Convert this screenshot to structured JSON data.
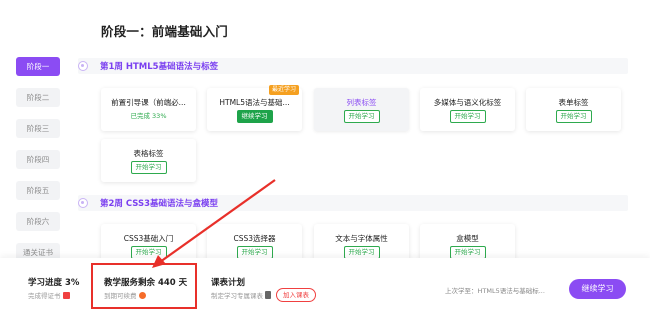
{
  "page_title": "阶段一：前端基础入门",
  "sidebar": {
    "stages": [
      {
        "label": "阶段一",
        "active": true
      },
      {
        "label": "阶段二",
        "active": false
      },
      {
        "label": "阶段三",
        "active": false
      },
      {
        "label": "阶段四",
        "active": false
      },
      {
        "label": "阶段五",
        "active": false
      },
      {
        "label": "阶段六",
        "active": false
      },
      {
        "label": "通关证书",
        "active": false
      }
    ]
  },
  "weeks": [
    {
      "title": "第1周 HTML5基础语法与标签",
      "courses": [
        {
          "title": "前置引导课（前端必...",
          "status": "已完成 33%"
        },
        {
          "title": "HTML5语法与基础...",
          "button": "继续学习",
          "badge": "最近学习"
        },
        {
          "title": "列表标签",
          "button": "开始学习"
        },
        {
          "title": "多媒体与语义化标签",
          "button": "开始学习"
        },
        {
          "title": "表单标签",
          "button": "开始学习"
        },
        {
          "title": "表格标签",
          "button": "开始学习"
        }
      ]
    },
    {
      "title": "第2周 CSS3基础语法与盒模型",
      "courses": [
        {
          "title": "CSS3基础入门",
          "button": "开始学习"
        },
        {
          "title": "CSS3选择器",
          "button": "开始学习"
        },
        {
          "title": "文本与字体属性",
          "button": "开始学习"
        },
        {
          "title": "盒模型",
          "button": "开始学习"
        }
      ]
    }
  ],
  "bottom": {
    "progress_title": "学习进度 3%",
    "progress_sub": "完成得证书",
    "service_title": "教学服务剩余 440 天",
    "service_sub": "到期可续费",
    "plan_title": "课表计划",
    "plan_sub": "制定学习专属课表",
    "join_button": "加入课表",
    "last_study": "上次学至：HTML5语法与基础标...",
    "continue_button": "继续学习"
  },
  "colors": {
    "accent": "#8b4cf3",
    "green": "#1ea34a",
    "highlight_red": "#e8302a"
  }
}
